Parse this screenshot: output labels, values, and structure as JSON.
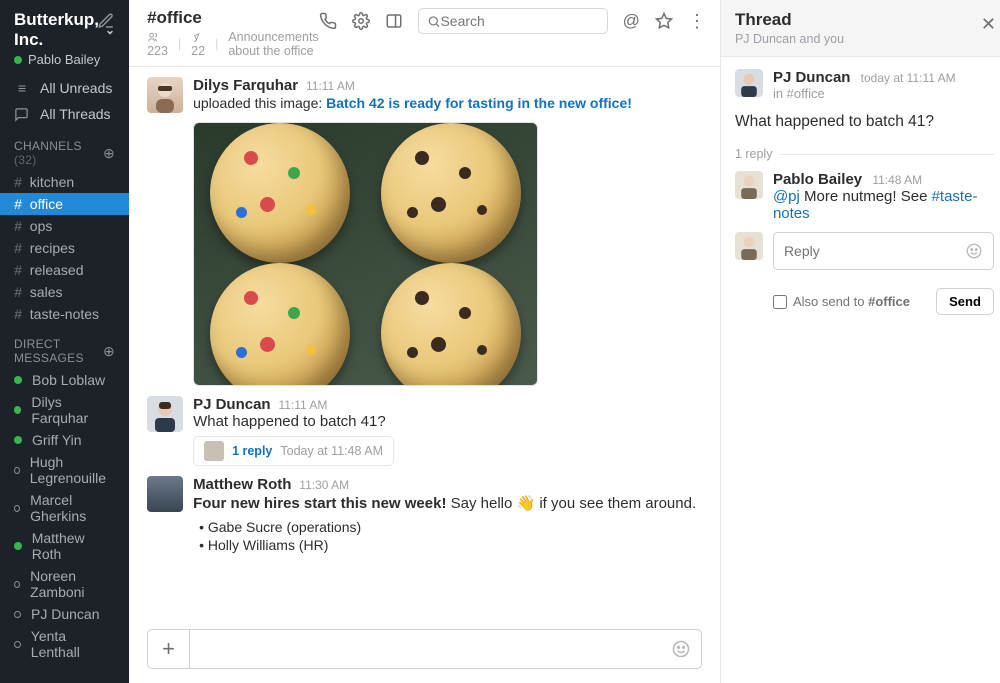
{
  "workspace": {
    "name": "Butterkup, Inc.",
    "user": "Pablo Bailey"
  },
  "nav": {
    "all_unreads": "All Unreads",
    "all_threads": "All Threads"
  },
  "channels": {
    "header": "CHANNELS",
    "count": "(32)",
    "items": [
      {
        "name": "kitchen"
      },
      {
        "name": "office",
        "active": true
      },
      {
        "name": "ops"
      },
      {
        "name": "recipes"
      },
      {
        "name": "released"
      },
      {
        "name": "sales"
      },
      {
        "name": "taste-notes"
      }
    ]
  },
  "dms": {
    "header": "DIRECT MESSAGES",
    "items": [
      {
        "name": "Bob Loblaw",
        "online": true
      },
      {
        "name": "Dilys Farquhar",
        "online": true
      },
      {
        "name": "Griff Yin",
        "online": true
      },
      {
        "name": "Hugh Legrenouille",
        "online": false
      },
      {
        "name": "Marcel Gherkins",
        "online": false
      },
      {
        "name": "Matthew Roth",
        "online": true
      },
      {
        "name": "Noreen Zamboni",
        "online": false
      },
      {
        "name": "PJ Duncan",
        "online": false
      },
      {
        "name": "Yenta Lenthall",
        "online": false
      }
    ]
  },
  "channel_header": {
    "title": "#office",
    "members": "223",
    "pins": "22",
    "topic": "Announcements about the office",
    "search_placeholder": "Search"
  },
  "messages": [
    {
      "author": "Dilys Farquhar",
      "time": "11:11 AM",
      "prefix": "uploaded this image: ",
      "link_text": "Batch 42 is ready for tasting in the new office!",
      "has_attachment": true
    },
    {
      "author": "PJ Duncan",
      "time": "11:11 AM",
      "text": "What happened to batch 41?",
      "thread": {
        "replies": "1 reply",
        "time": "Today at 11:48 AM"
      }
    },
    {
      "author": "Matthew Roth",
      "time": "11:30 AM",
      "text_bold": "Four new hires start this new week!",
      "text_rest": " Say hello 👋 if you see them around.",
      "bullets": [
        "Gabe Sucre (operations)",
        "Holly Williams (HR)"
      ]
    }
  ],
  "thread": {
    "title": "Thread",
    "subtitle": "PJ Duncan and you",
    "root": {
      "author": "PJ Duncan",
      "time": "today at 11:11 AM",
      "sub_prefix": "in ",
      "sub_link": "#office",
      "text": "What happened to batch 41?"
    },
    "reply_count": "1 reply",
    "replies": [
      {
        "author": "Pablo Bailey",
        "time": "11:48 AM",
        "mention": "@pj",
        "text": " More nutmeg! See ",
        "hashlink": "#taste-notes"
      }
    ],
    "compose": {
      "placeholder": "Reply",
      "also_send_prefix": "Also send to ",
      "also_send_channel": "#office",
      "send": "Send"
    }
  }
}
